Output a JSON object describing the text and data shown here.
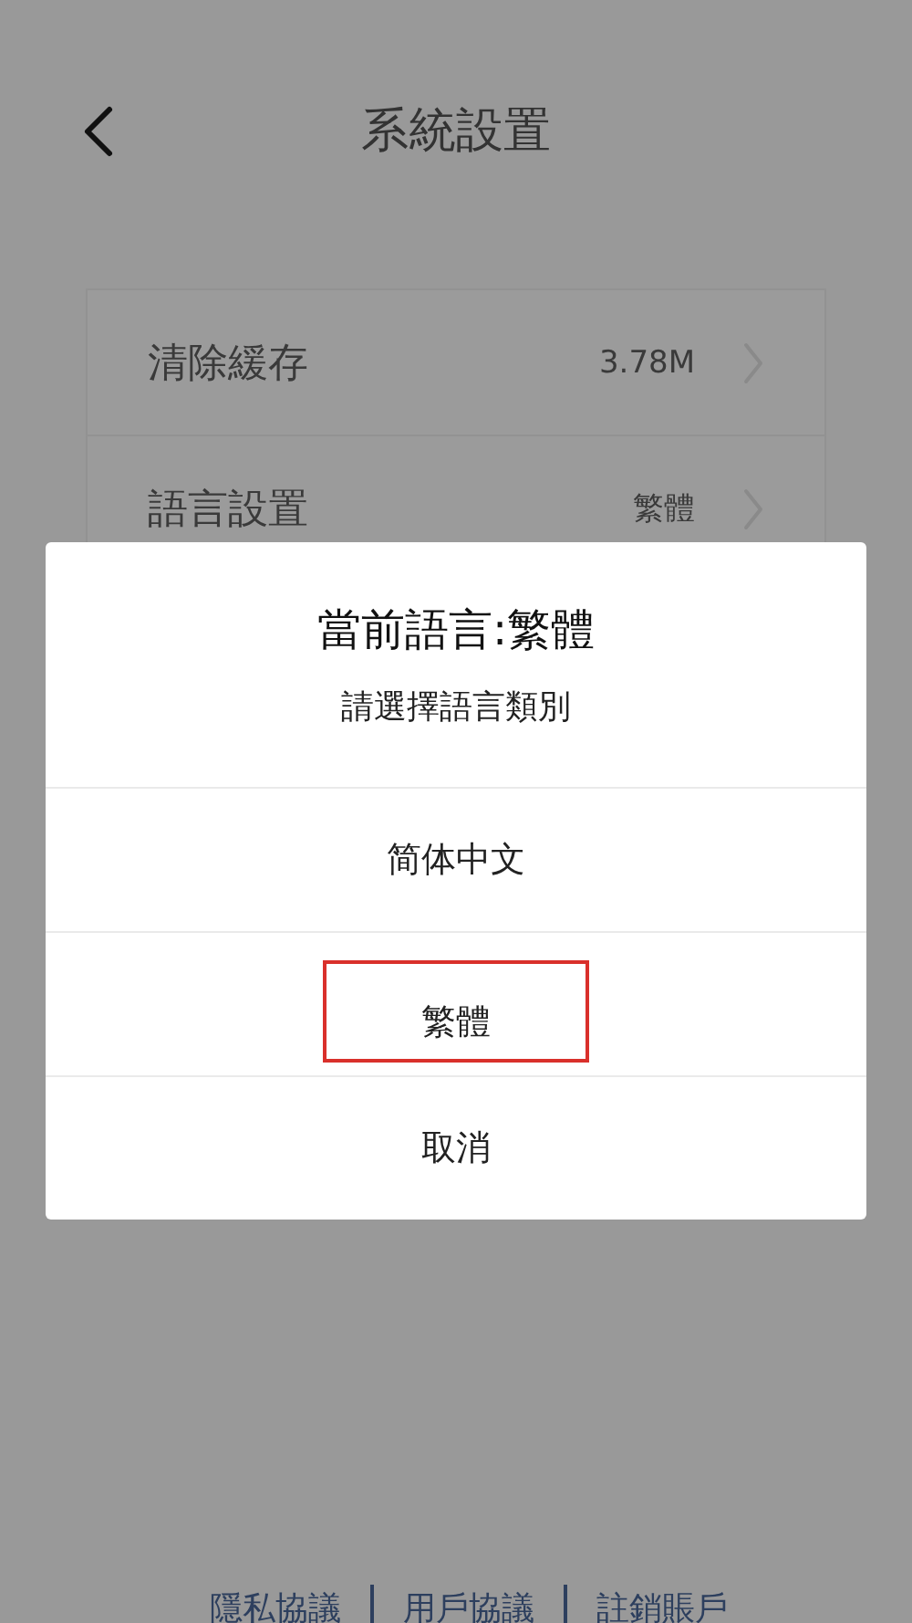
{
  "header": {
    "title": "系統設置"
  },
  "settings": [
    {
      "label": "清除緩存",
      "value": "3.78M"
    },
    {
      "label": "語言設置",
      "value": "繁體"
    }
  ],
  "dialog": {
    "title": "當前語言:繁體",
    "subtitle": "請選擇語言類別",
    "options": [
      {
        "label": "简体中文",
        "selected": false
      },
      {
        "label": "繁體",
        "selected": true
      },
      {
        "label": "取消",
        "selected": false
      }
    ]
  },
  "footer_links": [
    "隱私協議",
    "用戶協議",
    "註銷賬戶"
  ]
}
